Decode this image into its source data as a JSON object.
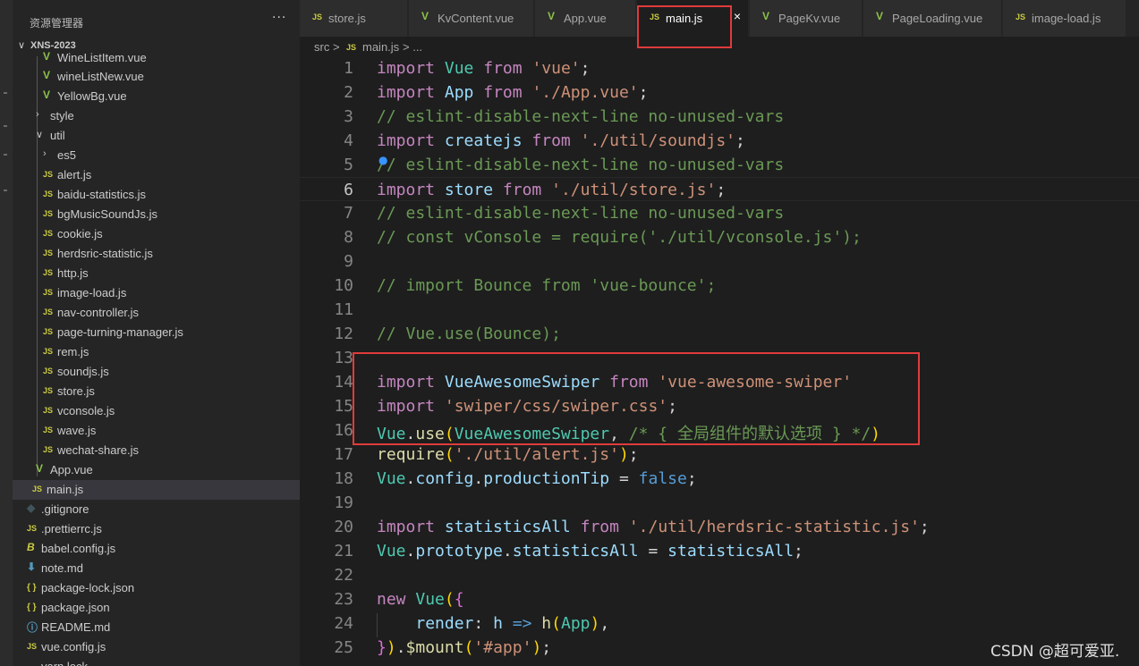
{
  "explorer": {
    "title": "资源管理器",
    "more": "···",
    "project": "XNS-2023",
    "items": [
      {
        "label": "WineListItem.vue",
        "icon": "vue"
      },
      {
        "label": "wineListNew.vue",
        "icon": "vue"
      },
      {
        "label": "YellowBg.vue",
        "icon": "vue"
      },
      {
        "label": "style",
        "icon": "folder-closed"
      },
      {
        "label": "util",
        "icon": "folder-open"
      },
      {
        "label": "es5",
        "icon": "folder-closed"
      },
      {
        "label": "alert.js",
        "icon": "js"
      },
      {
        "label": "baidu-statistics.js",
        "icon": "js"
      },
      {
        "label": "bgMusicSoundJs.js",
        "icon": "js"
      },
      {
        "label": "cookie.js",
        "icon": "js"
      },
      {
        "label": "herdsric-statistic.js",
        "icon": "js"
      },
      {
        "label": "http.js",
        "icon": "js"
      },
      {
        "label": "image-load.js",
        "icon": "js"
      },
      {
        "label": "nav-controller.js",
        "icon": "js"
      },
      {
        "label": "page-turning-manager.js",
        "icon": "js"
      },
      {
        "label": "rem.js",
        "icon": "js"
      },
      {
        "label": "soundjs.js",
        "icon": "js"
      },
      {
        "label": "store.js",
        "icon": "js"
      },
      {
        "label": "vconsole.js",
        "icon": "js"
      },
      {
        "label": "wave.js",
        "icon": "js"
      },
      {
        "label": "wechat-share.js",
        "icon": "js"
      },
      {
        "label": "App.vue",
        "icon": "vue"
      },
      {
        "label": "main.js",
        "icon": "js"
      },
      {
        "label": ".gitignore",
        "icon": "git"
      },
      {
        "label": ".prettierrc.js",
        "icon": "js"
      },
      {
        "label": "babel.config.js",
        "icon": "babel"
      },
      {
        "label": "note.md",
        "icon": "md"
      },
      {
        "label": "package-lock.json",
        "icon": "json"
      },
      {
        "label": "package.json",
        "icon": "json"
      },
      {
        "label": "README.md",
        "icon": "info"
      },
      {
        "label": "vue.config.js",
        "icon": "js"
      },
      {
        "label": "yarn.lock",
        "icon": "lock"
      }
    ]
  },
  "tabs": [
    {
      "label": "store.js",
      "icon": "js"
    },
    {
      "label": "KvContent.vue",
      "icon": "vue"
    },
    {
      "label": "App.vue",
      "icon": "vue"
    },
    {
      "label": "main.js",
      "icon": "js",
      "close": "×"
    },
    {
      "label": "PageKv.vue",
      "icon": "vue"
    },
    {
      "label": "PageLoading.vue",
      "icon": "vue"
    },
    {
      "label": "image-load.js",
      "icon": "js"
    }
  ],
  "breadcrumb": {
    "folder": "src",
    "sep": ">",
    "file": "main.js",
    "tail": "> ..."
  },
  "icon_labels": {
    "js": "JS",
    "vue": "V",
    "json": "{ }",
    "git": "◆",
    "md": "⬇",
    "info": "ⓘ",
    "babel": "B"
  },
  "code_lines": [
    {
      "num": "1",
      "text": "import Vue from 'vue';"
    },
    {
      "num": "2",
      "text": "import App from './App.vue';"
    },
    {
      "num": "3",
      "text": "// eslint-disable-next-line no-unused-vars"
    },
    {
      "num": "4",
      "text": "import createjs from './util/soundjs';"
    },
    {
      "num": "5",
      "text": "// eslint-disable-next-line no-unused-vars"
    },
    {
      "num": "6",
      "text": "import store from './util/store.js';"
    },
    {
      "num": "7",
      "text": "// eslint-disable-next-line no-unused-vars"
    },
    {
      "num": "8",
      "text": "// const vConsole = require('./util/vconsole.js');"
    },
    {
      "num": "9",
      "text": ""
    },
    {
      "num": "10",
      "text": "// import Bounce from 'vue-bounce';"
    },
    {
      "num": "11",
      "text": ""
    },
    {
      "num": "12",
      "text": "// Vue.use(Bounce);"
    },
    {
      "num": "13",
      "text": ""
    },
    {
      "num": "14",
      "text": "import VueAwesomeSwiper from 'vue-awesome-swiper'"
    },
    {
      "num": "15",
      "text": "import 'swiper/css/swiper.css';"
    },
    {
      "num": "16",
      "text": "Vue.use(VueAwesomeSwiper, /* { 全局组件的默认选项 } */)"
    },
    {
      "num": "17",
      "text": "require('./util/alert.js');"
    },
    {
      "num": "18",
      "text": "Vue.config.productionTip = false;"
    },
    {
      "num": "19",
      "text": ""
    },
    {
      "num": "20",
      "text": "import statisticsAll from './util/herdsric-statistic.js';"
    },
    {
      "num": "21",
      "text": "Vue.prototype.statisticsAll = statisticsAll;"
    },
    {
      "num": "22",
      "text": ""
    },
    {
      "num": "23",
      "text": "new Vue({"
    },
    {
      "num": "24",
      "text": "    render: h => h(App),"
    },
    {
      "num": "25",
      "text": "}).$mount('#app');"
    }
  ],
  "watermark": "CSDN @超可爱亚.",
  "colors": {
    "keyword": "#c586c0",
    "variable": "#9cdcfe",
    "class": "#4ec9b0",
    "string": "#ce9178",
    "comment": "#6a9955",
    "function": "#dcdcaa",
    "highlight_box": "#e03b3b"
  }
}
